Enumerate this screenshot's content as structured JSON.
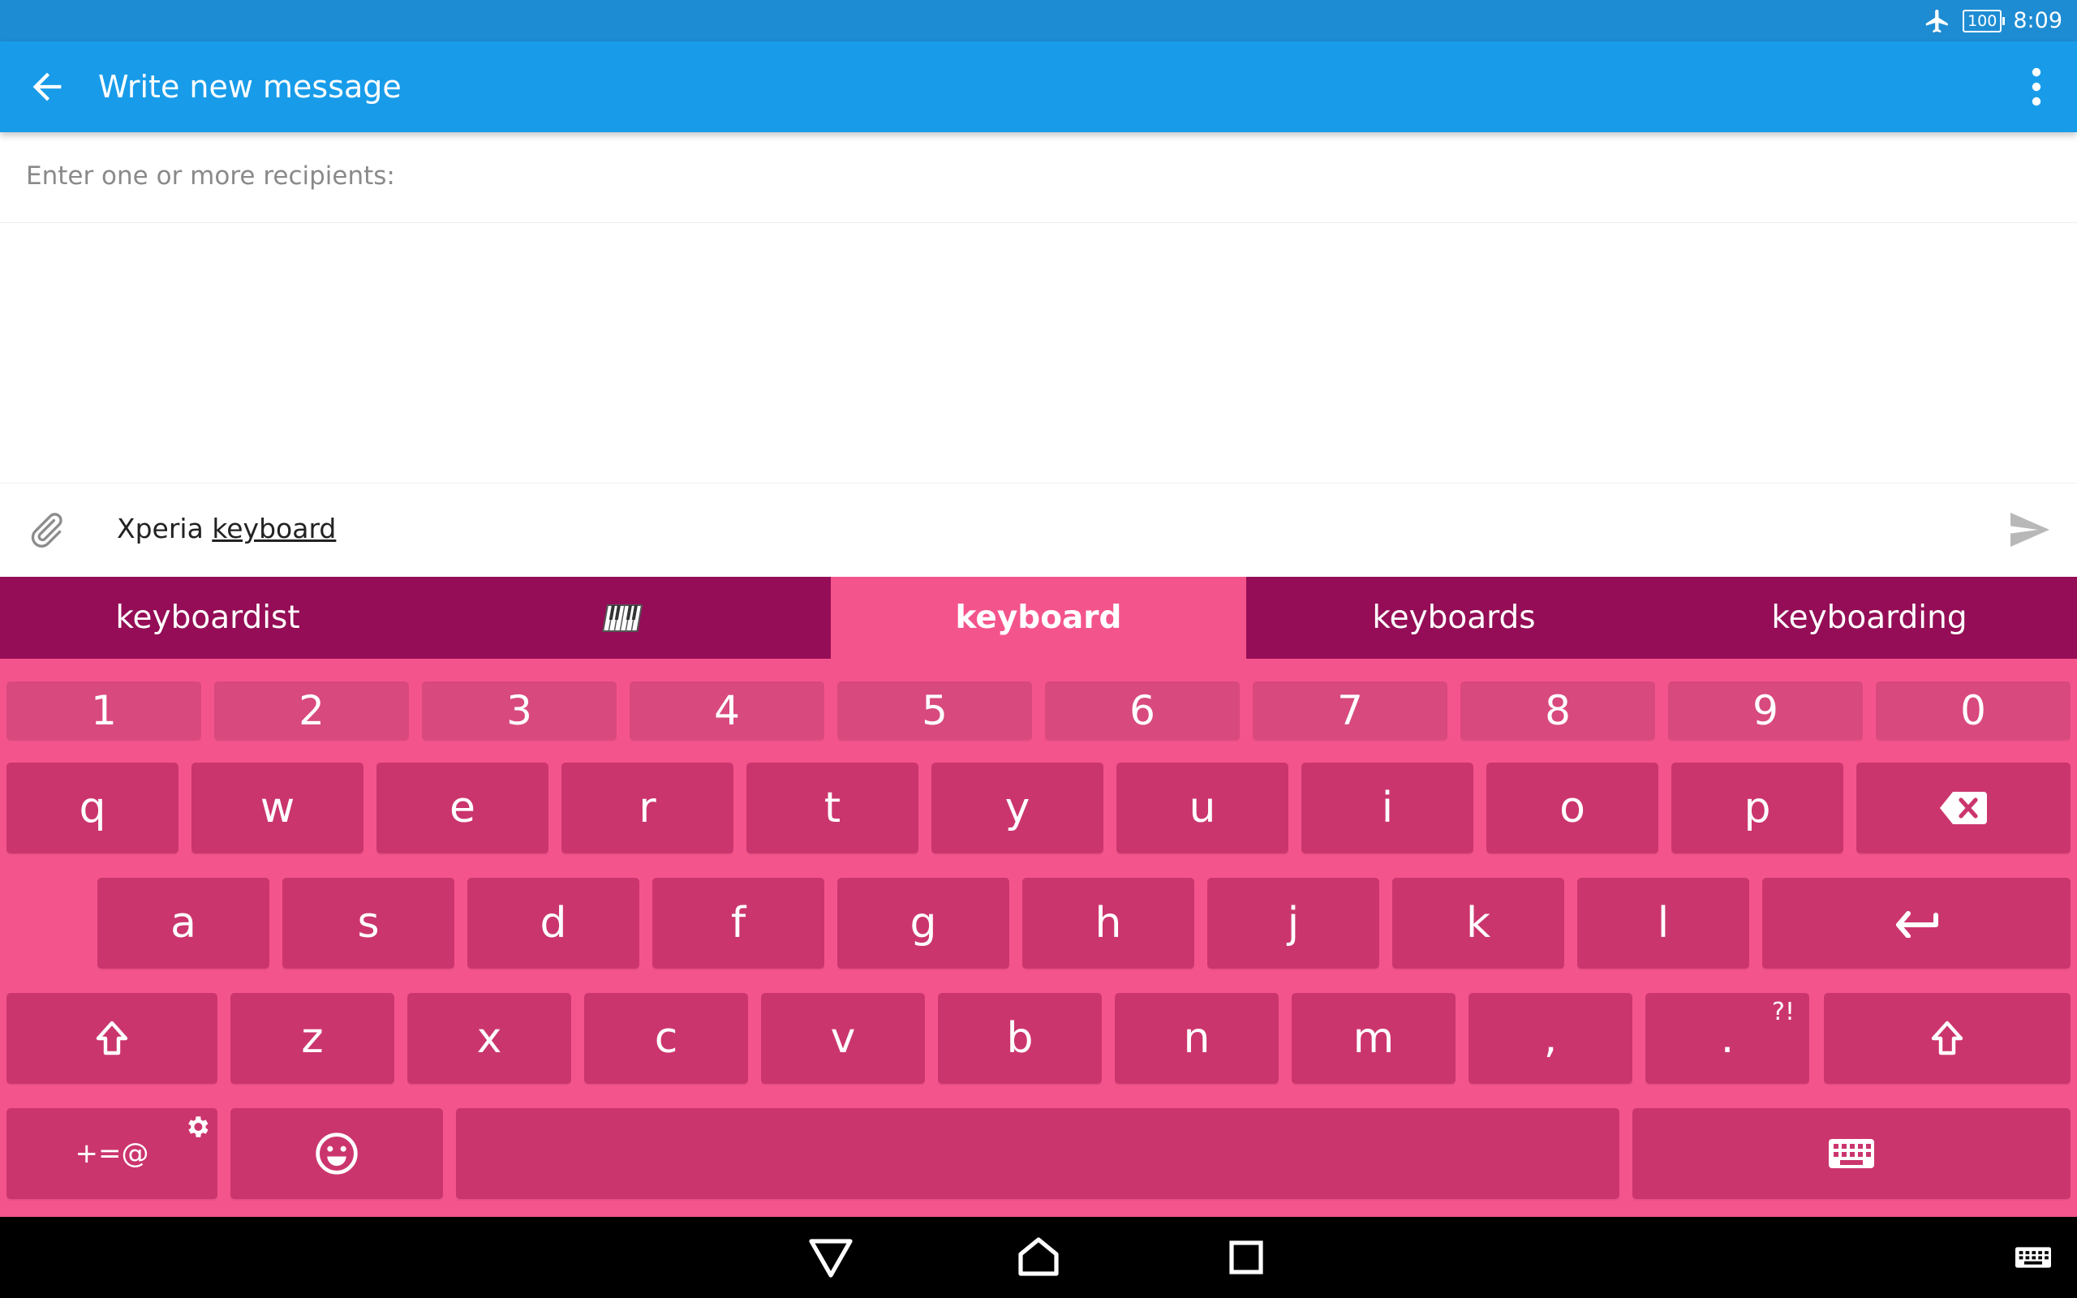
{
  "status": {
    "battery": "100",
    "time": "8:09",
    "airplane_icon": "airplane-icon"
  },
  "appbar": {
    "title": "Write new message",
    "back_icon": "back-arrow-icon",
    "menu_icon": "more-vert-icon"
  },
  "recipients": {
    "placeholder": "Enter one or more recipients:"
  },
  "compose": {
    "text_plain": "Xperia ",
    "text_underlined": "keyboard",
    "attach_icon": "paperclip-icon",
    "send_icon": "send-icon"
  },
  "suggestions": {
    "items": [
      "keyboardist",
      "",
      "keyboard",
      "keyboards",
      "keyboarding"
    ],
    "piano_icon": "piano-keyboard-icon"
  },
  "keyboard": {
    "numbers": [
      "1",
      "2",
      "3",
      "4",
      "5",
      "6",
      "7",
      "8",
      "9",
      "0"
    ],
    "row1": [
      "q",
      "w",
      "e",
      "r",
      "t",
      "y",
      "u",
      "i",
      "o",
      "p"
    ],
    "row2": [
      "a",
      "s",
      "d",
      "f",
      "g",
      "h",
      "j",
      "k",
      "l"
    ],
    "row3": [
      "z",
      "x",
      "c",
      "v",
      "b",
      "n",
      "m",
      ",",
      "."
    ],
    "period_sub": "?!",
    "symbols_label": "+=@"
  },
  "colors": {
    "statusbar": "#1E8CD3",
    "appbar": "#189CEA",
    "suggestion_bar": "#940D56",
    "keyboard_bg": "#F4548C",
    "key": "#CB356D"
  }
}
